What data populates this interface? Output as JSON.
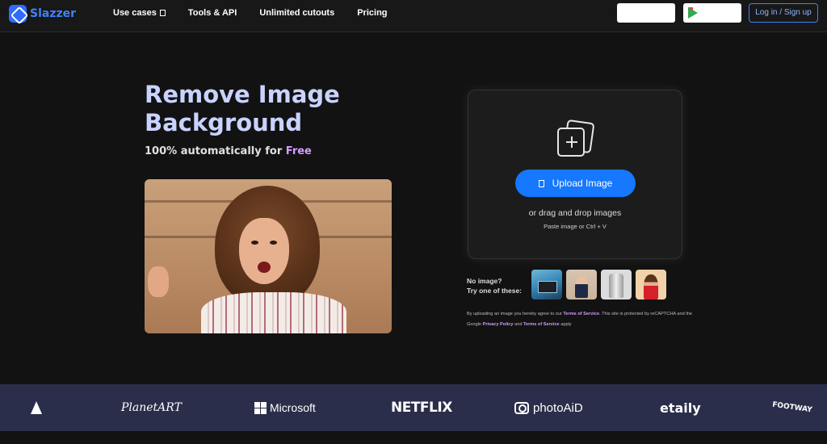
{
  "header": {
    "logo_text": "Slazzer",
    "nav": [
      {
        "label": "Use cases",
        "has_dropdown": true
      },
      {
        "label": "Tools & API"
      },
      {
        "label": "Unlimited cutouts"
      },
      {
        "label": "Pricing"
      }
    ],
    "login_label": "Log in / Sign up"
  },
  "hero": {
    "title": "Remove Image Background",
    "subtitle_prefix": "100% automatically for ",
    "subtitle_highlight": "Free"
  },
  "upload": {
    "button_label": "Upload Image",
    "drag_text": "or drag and drop images",
    "paste_text": "Paste image or Ctrl + V"
  },
  "samples": {
    "label_line1": "No image?",
    "label_line2": "Try one of these:"
  },
  "terms": {
    "part1": "By uploading an image you hereby agree to our ",
    "terms_link": "Terms of Service",
    "part2": ". This site is protected by reCAPTCHA and the Google ",
    "privacy_link": "Privacy Policy",
    "part3": " and ",
    "terms_link2": "Terms of Service",
    "part4": " apply"
  },
  "brands": {
    "planetart": "PlanetART",
    "microsoft": "Microsoft",
    "netflix": "NETFLIX",
    "photoaid": "photoAiD",
    "etaily": "etaily",
    "footway": "FOOTWAY"
  },
  "colors": {
    "accent": "#1677ff",
    "title": "#c9d3ff",
    "highlight": "#d59cff",
    "brand_strip": "#2b2e4a"
  }
}
